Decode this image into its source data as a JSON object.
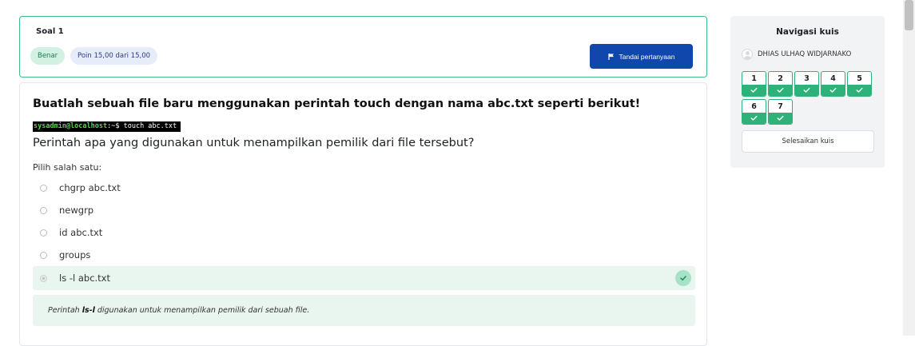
{
  "question": {
    "number_label": "Soal 1",
    "status_badge": "Benar",
    "points_badge": "Poin 15,00 dari 15,00",
    "flag_label": "Tandai pertanyaan",
    "heading": "Buatlah sebuah file baru menggunakan perintah touch dengan nama abc.txt seperti berikut!",
    "terminal_host": "sysadmin@localhost",
    "terminal_command": ":~$ touch abc.txt",
    "prompt": "Perintah apa yang digunakan untuk menampilkan pemilik dari file tersebut?",
    "choose_label": "Pilih salah satu:",
    "options": [
      {
        "label": "chgrp abc.txt"
      },
      {
        "label": "newgrp"
      },
      {
        "label": "id abc.txt"
      },
      {
        "label": "groups"
      },
      {
        "label": "ls -l abc.txt",
        "selected": true,
        "correct": true
      }
    ],
    "feedback": {
      "before": "Perintah",
      "bold": "ls-l",
      "after": "digunakan untuk menampilkan pemilik dari sebuah file."
    }
  },
  "navigation": {
    "title": "Navigasi kuis",
    "user_name": "DHIAS ULHAQ WIDJARNAKO",
    "questions": [
      {
        "num": "1",
        "state": "correct"
      },
      {
        "num": "2",
        "state": "correct"
      },
      {
        "num": "3",
        "state": "correct"
      },
      {
        "num": "4",
        "state": "correct"
      },
      {
        "num": "5",
        "state": "correct"
      },
      {
        "num": "6",
        "state": "correct"
      },
      {
        "num": "7",
        "state": "correct"
      }
    ],
    "finish_label": "Selesaikan kuis"
  },
  "colors": {
    "accent_blue": "#0f47ad",
    "correct_green": "#2fb27a",
    "correct_bg": "#e8f6ef"
  },
  "icons": [
    "flag-icon",
    "check-icon",
    "avatar-icon"
  ]
}
